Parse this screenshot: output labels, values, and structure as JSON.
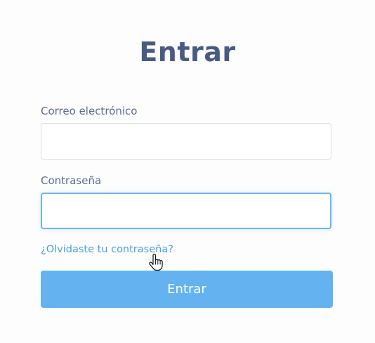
{
  "form": {
    "title": "Entrar",
    "email": {
      "label": "Correo electrónico",
      "value": "",
      "placeholder": ""
    },
    "password": {
      "label": "Contraseña",
      "value": "",
      "placeholder": ""
    },
    "forgot_link": "¿Olvidaste tu contraseña?",
    "submit_label": "Entrar"
  },
  "pointer": {
    "icon": "hand-pointer-icon"
  },
  "colors": {
    "title": "#4a5b83",
    "link": "#4a9fe0",
    "button": "#64b3f0",
    "focus_border": "#6eb4ec"
  }
}
